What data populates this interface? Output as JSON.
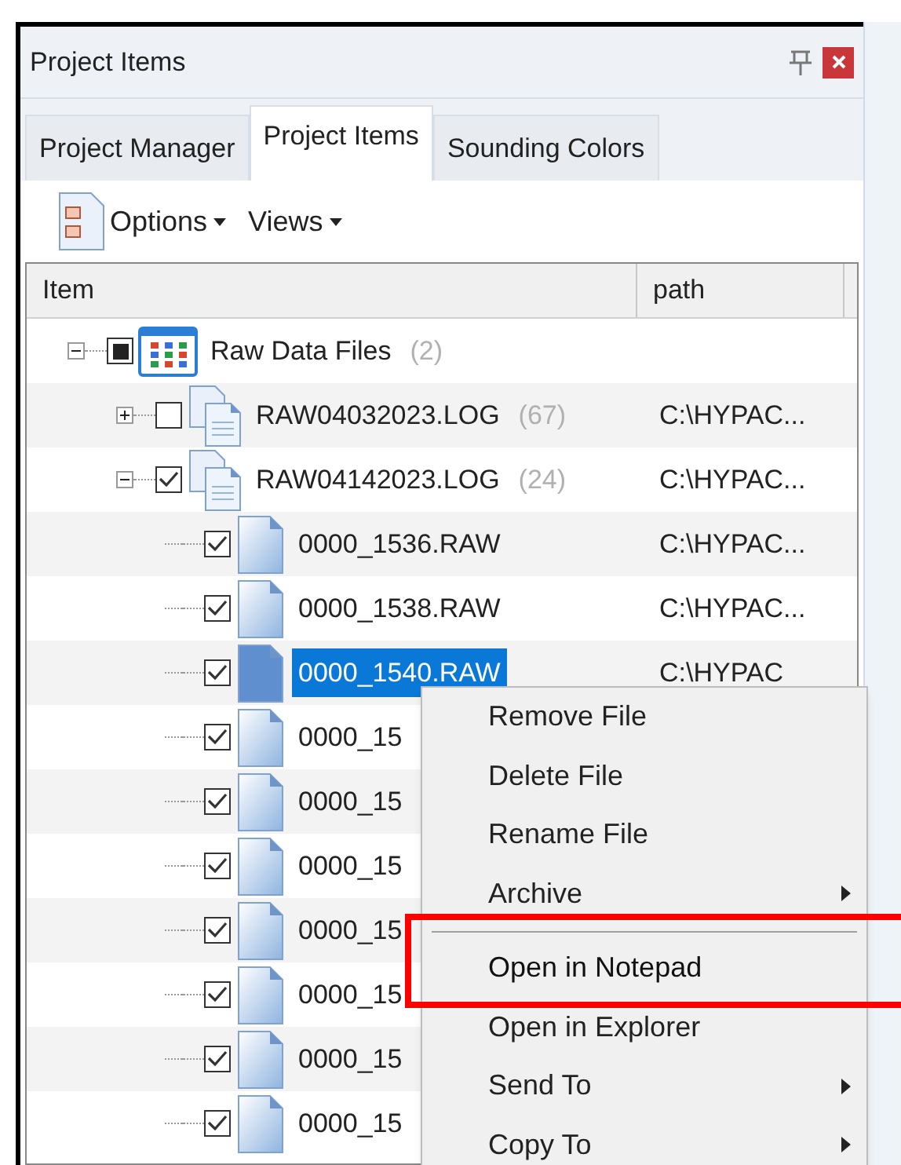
{
  "panel": {
    "title": "Project Items"
  },
  "tabs": [
    {
      "label": "Project Manager",
      "selected": false
    },
    {
      "label": "Project Items",
      "selected": true
    },
    {
      "label": "Sounding Colors",
      "selected": false
    }
  ],
  "toolbar": [
    {
      "label": "Options",
      "kind": "icon-dropdown"
    },
    {
      "label": "Views",
      "kind": "dropdown"
    }
  ],
  "columns": [
    "Item",
    "path"
  ],
  "tree": [
    {
      "kind": "group",
      "label": "Raw Data Files",
      "count": "(2)",
      "partial": true,
      "expanded": true,
      "children": [
        {
          "kind": "log",
          "label": "RAW04032023.LOG",
          "count": "(67)",
          "path": "C:\\HYPAC...",
          "checked": false,
          "expanded": false
        },
        {
          "kind": "log",
          "label": "RAW04142023.LOG",
          "count": "(24)",
          "path": "C:\\HYPAC...",
          "checked": true,
          "expanded": true,
          "children": [
            {
              "kind": "file",
              "label": "0000_1536.RAW",
              "path": "C:\\HYPAC...",
              "checked": true,
              "selected": false
            },
            {
              "kind": "file",
              "label": "0000_1538.RAW",
              "path": "C:\\HYPAC...",
              "checked": true,
              "selected": false
            },
            {
              "kind": "file",
              "label": "0000_1540.RAW",
              "path": "C:\\HYPAC",
              "checked": true,
              "selected": true
            },
            {
              "kind": "file",
              "label": "0000_15",
              "checked": true,
              "selected": false
            },
            {
              "kind": "file",
              "label": "0000_15",
              "checked": true,
              "selected": false
            },
            {
              "kind": "file",
              "label": "0000_15",
              "checked": true,
              "selected": false
            },
            {
              "kind": "file",
              "label": "0000_15",
              "checked": true,
              "selected": false
            },
            {
              "kind": "file",
              "label": "0000_15",
              "checked": true,
              "selected": false
            },
            {
              "kind": "file",
              "label": "0000_15",
              "checked": true,
              "selected": false
            },
            {
              "kind": "file",
              "label": "0000_15",
              "checked": true,
              "selected": false
            }
          ]
        }
      ]
    }
  ],
  "context_menu": [
    {
      "kind": "item",
      "label": "Remove File",
      "highlighted": false
    },
    {
      "kind": "item",
      "label": "Delete File",
      "highlighted": false
    },
    {
      "kind": "item",
      "label": "Rename File",
      "highlighted": false
    },
    {
      "kind": "submenu",
      "label": "Archive",
      "highlighted": false
    },
    {
      "kind": "separator"
    },
    {
      "kind": "item",
      "label": "Open in Notepad",
      "highlighted": true
    },
    {
      "kind": "item",
      "label": "Open in Explorer",
      "highlighted": false
    },
    {
      "kind": "submenu",
      "label": "Send To",
      "highlighted": false
    },
    {
      "kind": "submenu",
      "label": "Copy To",
      "highlighted": false
    }
  ]
}
